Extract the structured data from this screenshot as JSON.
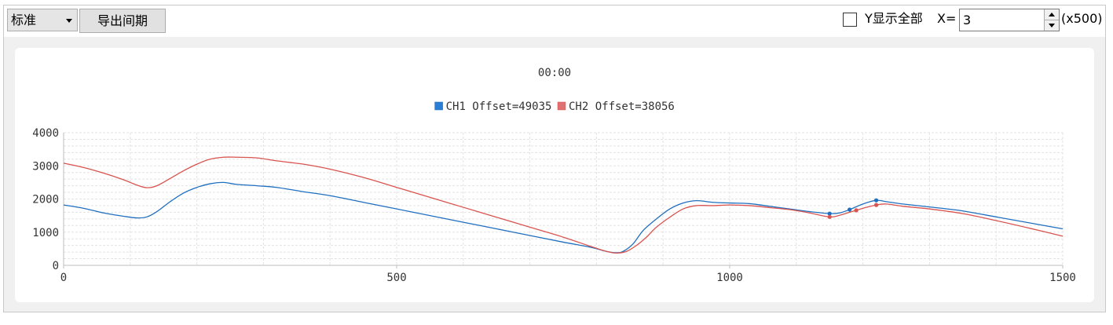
{
  "toolbar": {
    "mode_select": "标准",
    "export_button": "导出间期",
    "y_show_all_label": "Y显示全部",
    "y_show_all_checked": false,
    "x_label": "X=",
    "x_value": "3",
    "x_unit": "(x500)"
  },
  "chart_data": {
    "type": "line",
    "title": "00:00",
    "xlabel": "",
    "ylabel": "",
    "xlim": [
      0,
      1500
    ],
    "ylim": [
      0,
      4000
    ],
    "x_ticks": [
      0,
      500,
      1000,
      1500
    ],
    "y_ticks": [
      0,
      1000,
      2000,
      3000,
      4000
    ],
    "grid": true,
    "legend_position": "top-center",
    "series": [
      {
        "name": "CH1 Offset=49035",
        "color": "#1f6fbf",
        "legend_color": "#2a7fd4",
        "x": [
          0,
          30,
          60,
          90,
          110,
          125,
          140,
          160,
          180,
          200,
          220,
          240,
          260,
          290,
          320,
          360,
          400,
          450,
          500,
          550,
          600,
          650,
          700,
          750,
          790,
          815,
          830,
          840,
          855,
          870,
          890,
          910,
          930,
          950,
          975,
          1000,
          1030,
          1060,
          1090,
          1120,
          1150,
          1165,
          1180,
          1200,
          1220,
          1235,
          1260,
          1300,
          1350,
          1400,
          1450,
          1500
        ],
        "y": [
          1820,
          1720,
          1580,
          1480,
          1430,
          1460,
          1620,
          1920,
          2180,
          2350,
          2460,
          2500,
          2440,
          2400,
          2350,
          2220,
          2100,
          1900,
          1700,
          1500,
          1300,
          1100,
          900,
          700,
          550,
          420,
          380,
          420,
          650,
          1050,
          1400,
          1700,
          1880,
          1950,
          1900,
          1880,
          1860,
          1780,
          1700,
          1620,
          1560,
          1580,
          1680,
          1850,
          1960,
          1920,
          1850,
          1760,
          1640,
          1460,
          1280,
          1100
        ],
        "highlights": [
          [
            1150,
            1560
          ],
          [
            1180,
            1680
          ],
          [
            1220,
            1960
          ]
        ]
      },
      {
        "name": "CH2 Offset=38056",
        "color": "#d9534f",
        "legend_color": "#e07070",
        "x": [
          0,
          30,
          60,
          90,
          110,
          125,
          140,
          160,
          180,
          200,
          220,
          240,
          260,
          290,
          320,
          360,
          400,
          450,
          500,
          550,
          600,
          650,
          700,
          750,
          790,
          815,
          830,
          845,
          860,
          875,
          890,
          910,
          930,
          950,
          975,
          1000,
          1030,
          1060,
          1090,
          1120,
          1150,
          1165,
          1180,
          1200,
          1220,
          1235,
          1260,
          1300,
          1350,
          1400,
          1450,
          1500
        ],
        "y": [
          3080,
          2950,
          2780,
          2580,
          2420,
          2340,
          2400,
          2620,
          2850,
          3050,
          3200,
          3260,
          3260,
          3240,
          3150,
          3050,
          2900,
          2650,
          2350,
          2050,
          1750,
          1450,
          1150,
          850,
          580,
          420,
          370,
          420,
          600,
          850,
          1150,
          1450,
          1700,
          1800,
          1800,
          1820,
          1800,
          1740,
          1680,
          1580,
          1460,
          1510,
          1600,
          1720,
          1820,
          1850,
          1780,
          1700,
          1560,
          1350,
          1120,
          880
        ],
        "highlights": [
          [
            1150,
            1460
          ],
          [
            1190,
            1660
          ],
          [
            1220,
            1820
          ]
        ]
      }
    ]
  }
}
